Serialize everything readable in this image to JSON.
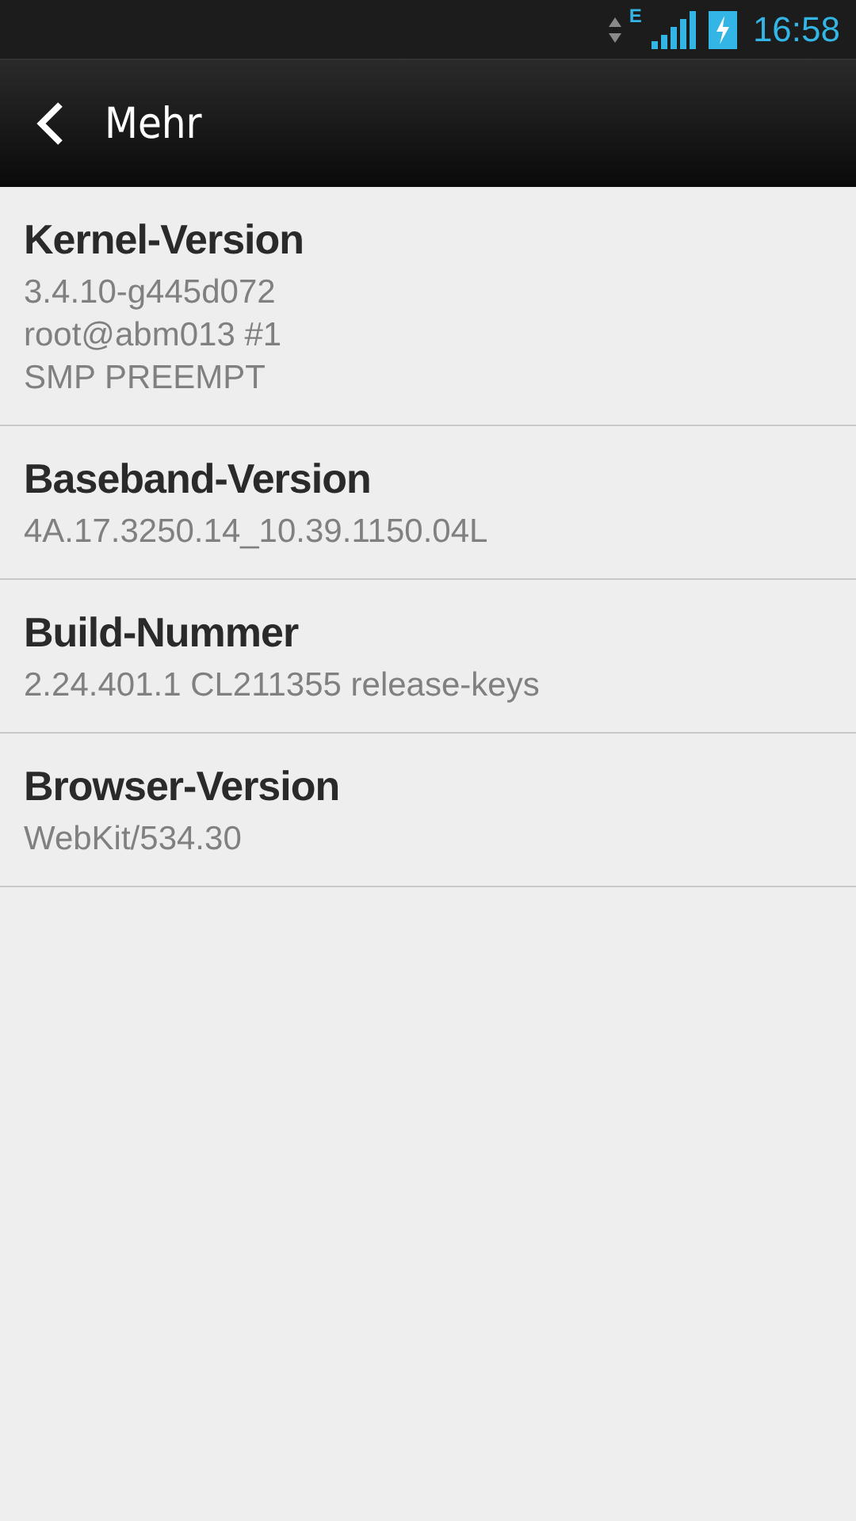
{
  "status_bar": {
    "network_type": "E",
    "time": "16:58"
  },
  "header": {
    "title": "Mehr"
  },
  "items": [
    {
      "title": "Kernel-Version",
      "lines": [
        "3.4.10-g445d072",
        "root@abm013 #1",
        "SMP PREEMPT"
      ]
    },
    {
      "title": "Baseband-Version",
      "lines": [
        "4A.17.3250.14_10.39.1150.04L"
      ]
    },
    {
      "title": "Build-Nummer",
      "lines": [
        "2.24.401.1 CL211355 release-keys"
      ]
    },
    {
      "title": "Browser-Version",
      "lines": [
        "WebKit/534.30"
      ]
    }
  ]
}
